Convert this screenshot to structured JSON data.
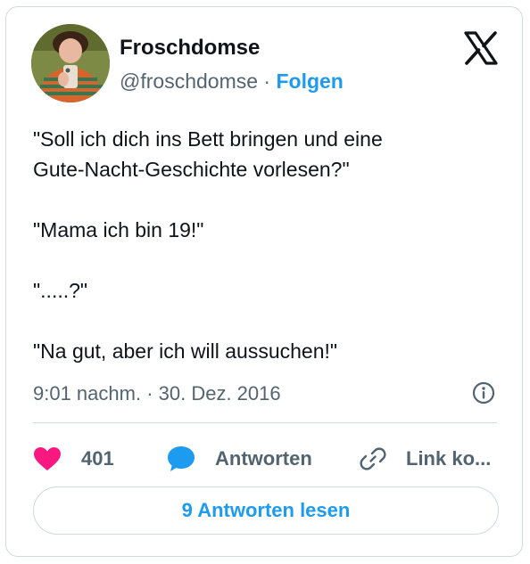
{
  "tweet": {
    "display_name": "Froschdomse",
    "handle": "@froschdomse",
    "separator": " · ",
    "follow_label": "Folgen",
    "text_lines": [
      "\"Soll ich dich ins Bett bringen und eine",
      "Gute-Nacht-Geschichte vorlesen?\"",
      "\"Mama ich bin 19!\"",
      "\".....?\"",
      "\"Na gut, aber ich will aussuchen!\""
    ],
    "timestamp": "9:01 nachm. · 30. Dez. 2016"
  },
  "actions": {
    "likes": "401",
    "reply_label": "Antworten",
    "copy_link_label": "Link ko..."
  },
  "read_replies_label": "9 Antworten lesen",
  "icons": {
    "brand": "x-logo-icon",
    "info": "info-icon",
    "like": "heart-icon",
    "reply": "speech-bubble-icon",
    "link": "link-icon"
  },
  "colors": {
    "accent": "#1d9bf0",
    "like": "#f91880",
    "secondary_text": "#536471",
    "border": "#cfd9de"
  }
}
